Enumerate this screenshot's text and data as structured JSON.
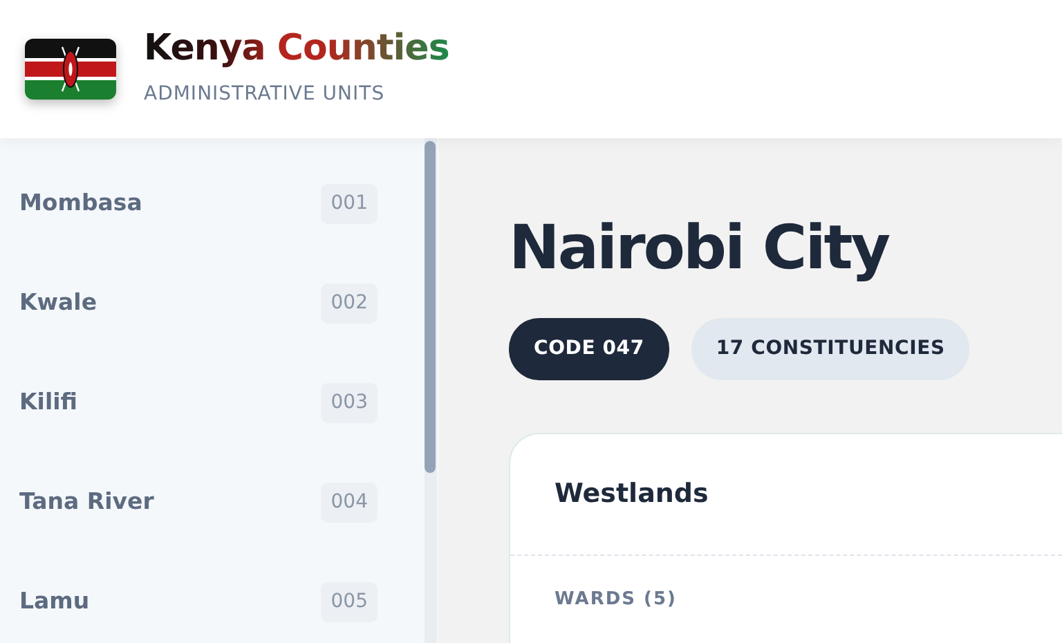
{
  "header": {
    "title": "Kenya Counties",
    "subtitle": "ADMINISTRATIVE UNITS"
  },
  "sidebar": {
    "items": [
      {
        "name": "Mombasa",
        "code": "001"
      },
      {
        "name": "Kwale",
        "code": "002"
      },
      {
        "name": "Kilifi",
        "code": "003"
      },
      {
        "name": "Tana River",
        "code": "004"
      },
      {
        "name": "Lamu",
        "code": "005"
      }
    ]
  },
  "county": {
    "title": "Nairobi City",
    "tags": [
      {
        "label": "CODE 047",
        "kind": "dark"
      },
      {
        "label": "17 CONSTITUENCIES",
        "kind": "light"
      }
    ]
  },
  "constituency": {
    "name": "Westlands",
    "wards_label": "WARDS (5)"
  }
}
